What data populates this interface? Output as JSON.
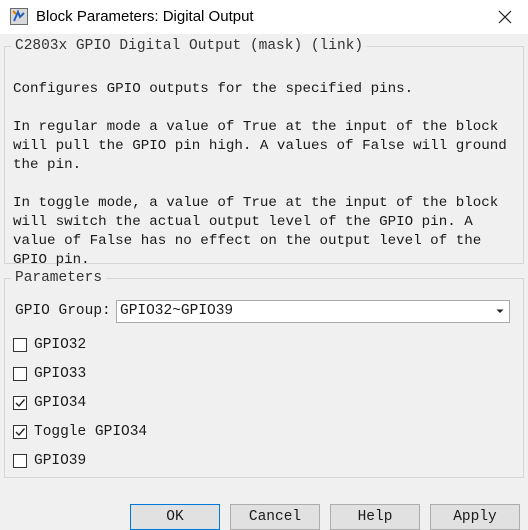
{
  "window": {
    "title": "Block Parameters: Digital Output"
  },
  "description": {
    "legend": "C2803x GPIO Digital Output (mask) (link)",
    "text": "Configures GPIO outputs for the specified pins.\n\nIn regular mode a value of True at the input of the block\nwill pull the GPIO pin high. A values of False will ground\nthe pin.\n\nIn toggle mode, a value of True at the input of the block\nwill switch the actual output level of the GPIO pin. A\nvalue of False has no effect on the output level of the\nGPIO pin."
  },
  "parameters": {
    "legend": "Parameters",
    "group_label": "GPIO Group:",
    "group_value": "GPIO32~GPIO39",
    "checkboxes": [
      {
        "label": "GPIO32",
        "checked": false
      },
      {
        "label": "GPIO33",
        "checked": false
      },
      {
        "label": "GPIO34",
        "checked": true
      },
      {
        "label": "Toggle GPIO34",
        "checked": true
      },
      {
        "label": "GPIO39",
        "checked": false
      }
    ]
  },
  "buttons": {
    "ok": "OK",
    "cancel": "Cancel",
    "help": "Help",
    "apply": "Apply"
  },
  "icons": {
    "app": "simulink-block-icon",
    "close": "close-icon",
    "dropdown": "chevron-down-icon",
    "check": "check-icon"
  }
}
